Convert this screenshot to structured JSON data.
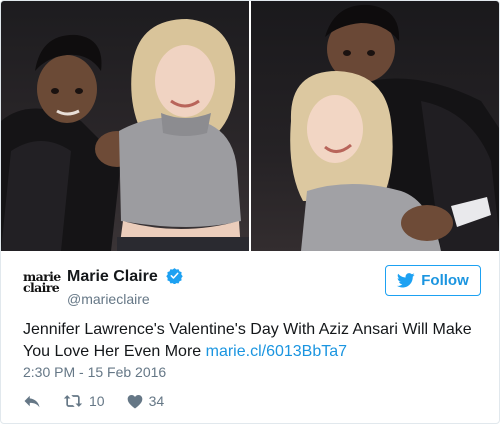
{
  "account": {
    "logo_line1": "marie",
    "logo_line2": "claire",
    "display_name": "Marie Claire",
    "handle": "@marieclaire",
    "verified": true
  },
  "follow_button": {
    "label": "Follow",
    "icon": "twitter-bird-icon"
  },
  "tweet": {
    "text": "Jennifer Lawrence's Valentine's Day With Aziz Ansari Will Make You Love Her Even More ",
    "link": "marie.cl/6013BbTa7",
    "timestamp": "2:30 PM - 15 Feb 2016"
  },
  "actions": {
    "reply_icon": "reply-icon",
    "retweet_icon": "retweet-icon",
    "retweet_count": "10",
    "like_icon": "heart-icon",
    "like_count": "34"
  },
  "colors": {
    "link": "#1b95e0",
    "verified": "#1da1f2",
    "muted": "#657786",
    "border": "#e1e8ed"
  }
}
